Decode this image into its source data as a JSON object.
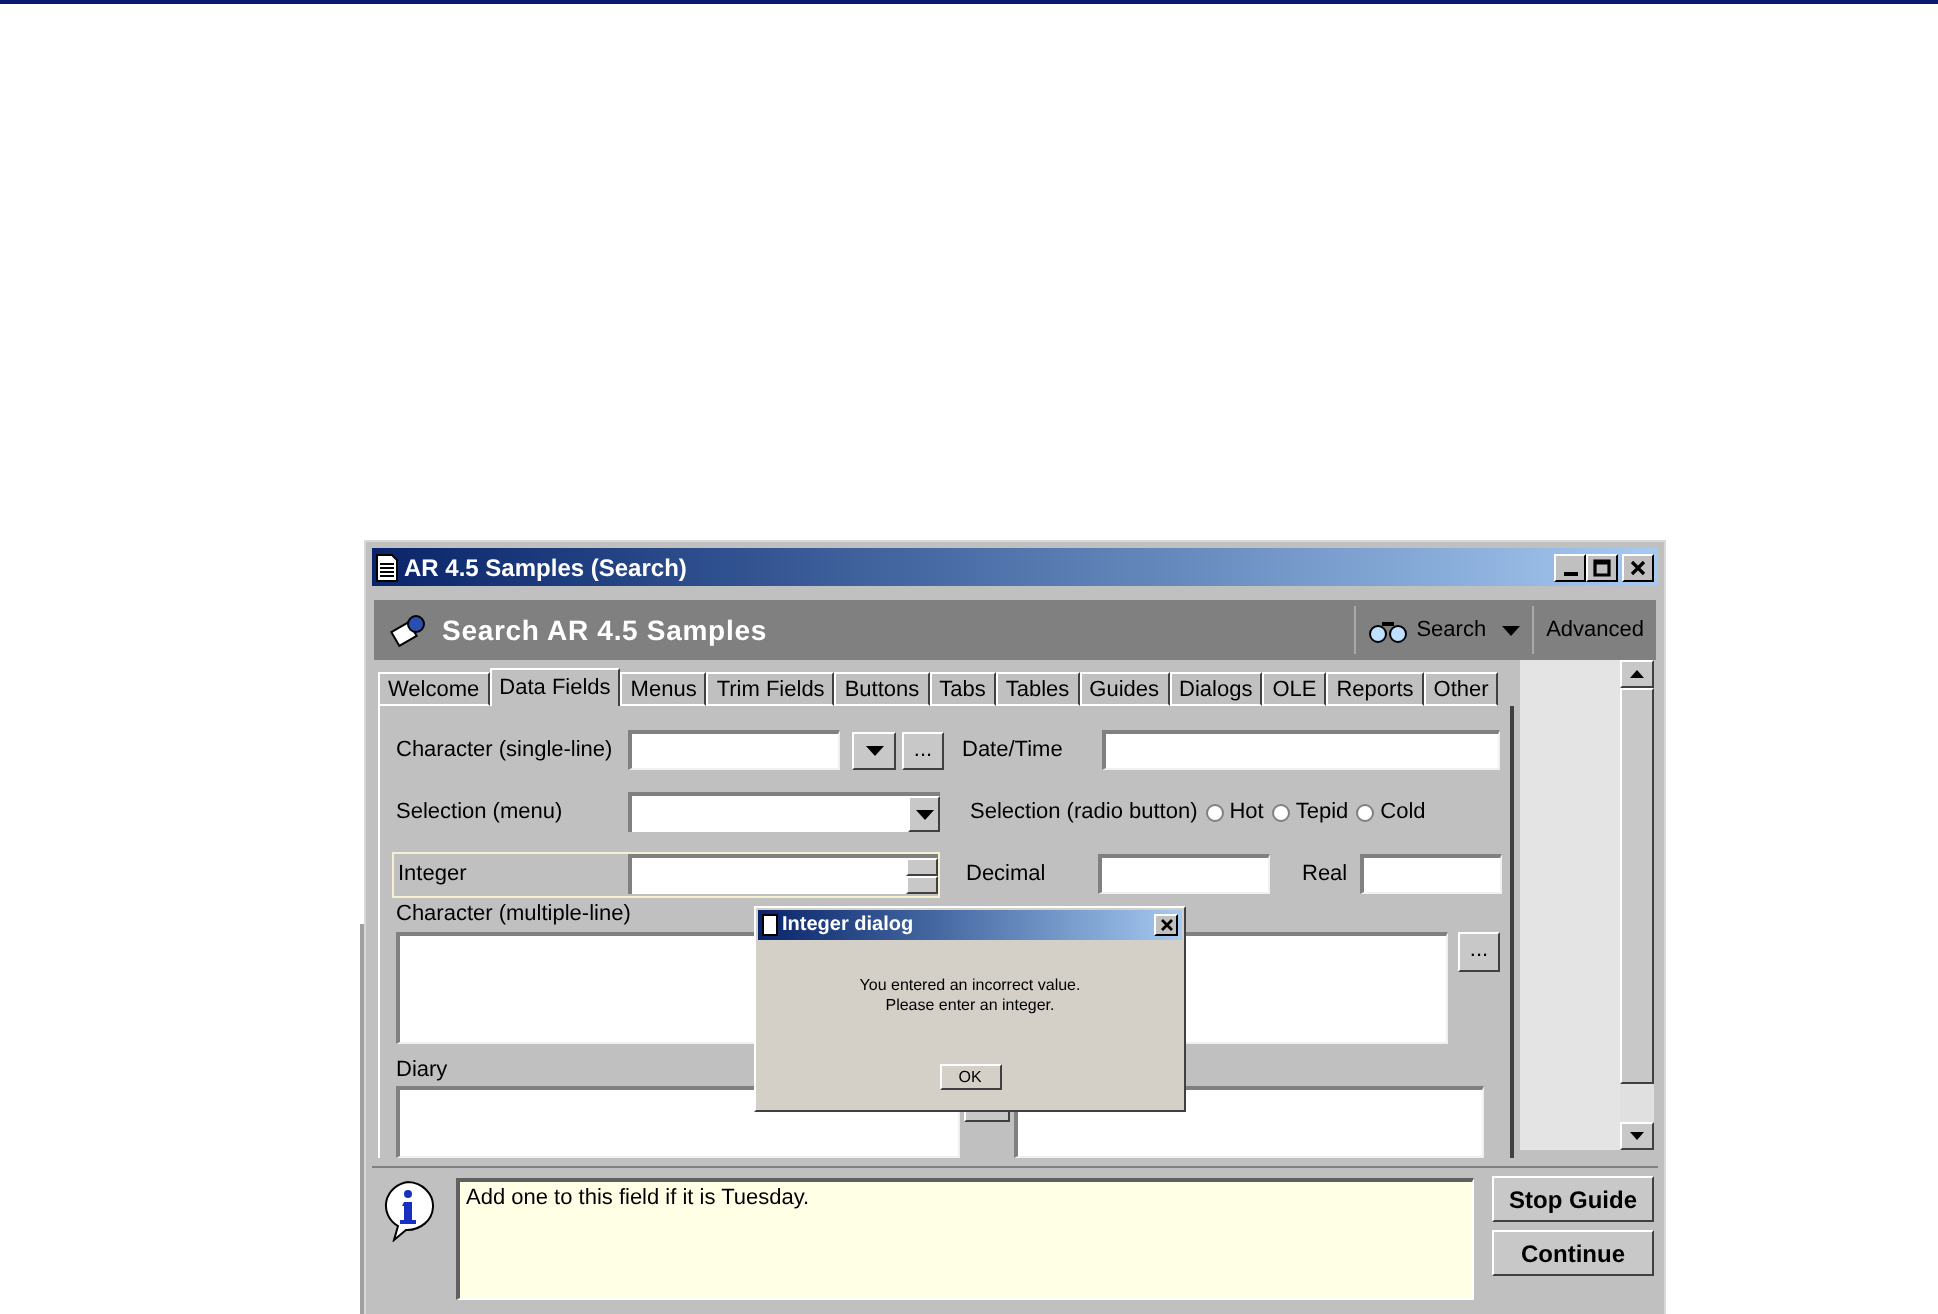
{
  "window": {
    "title": "AR 4.5 Samples (Search)"
  },
  "header": {
    "title": "Search AR 4.5 Samples",
    "search_button": "Search",
    "advanced_button": "Advanced"
  },
  "tabs": [
    {
      "label": "Welcome",
      "selected": false
    },
    {
      "label": "Data Fields",
      "selected": true
    },
    {
      "label": "Menus",
      "selected": false
    },
    {
      "label": "Trim Fields",
      "selected": false
    },
    {
      "label": "Buttons",
      "selected": false
    },
    {
      "label": "Tabs",
      "selected": false
    },
    {
      "label": "Tables",
      "selected": false
    },
    {
      "label": "Guides",
      "selected": false
    },
    {
      "label": "Dialogs",
      "selected": false
    },
    {
      "label": "OLE",
      "selected": false
    },
    {
      "label": "Reports",
      "selected": false
    },
    {
      "label": "Other",
      "selected": false
    }
  ],
  "form": {
    "character_single": "Character (single-line)",
    "more_button": "...",
    "datetime": "Date/Time",
    "selection_menu": "Selection (menu)",
    "selection_radio": "Selection (radio button)",
    "radios": [
      {
        "label": "Hot",
        "selected": false
      },
      {
        "label": "Tepid",
        "selected": false
      },
      {
        "label": "Cold",
        "selected": false
      }
    ],
    "integer": "Integer",
    "decimal": "Decimal",
    "real": "Real",
    "character_multi": "Character (multiple-line)",
    "multi_more_button": "...",
    "diary": "Diary"
  },
  "dialog": {
    "title": "Integer dialog",
    "message_1": "You entered an incorrect value.",
    "message_2": "Please enter an integer.",
    "ok_button": "OK"
  },
  "guide": {
    "message": "Add one to this field if it is Tuesday.",
    "stop_button": "Stop Guide",
    "continue_button": "Continue"
  }
}
